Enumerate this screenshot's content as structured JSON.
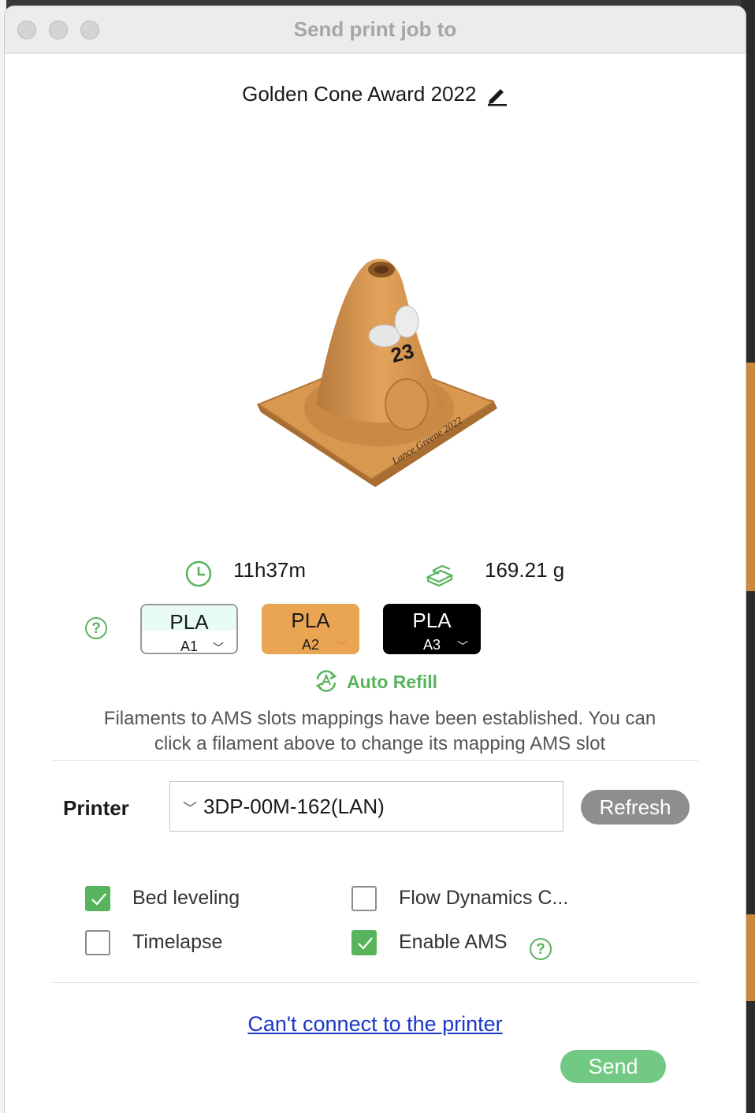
{
  "window": {
    "title": "Send print job to"
  },
  "job": {
    "name": "Golden Cone Award 2022"
  },
  "model_preview": {
    "label_number": "23",
    "engraving": "Lance Greene 2022"
  },
  "stats": {
    "print_time": "11h37m",
    "weight": "169.21 g"
  },
  "filaments": [
    {
      "type": "PLA",
      "slot": "A1",
      "color": "#ffffff"
    },
    {
      "type": "PLA",
      "slot": "A2",
      "color": "#eaa553"
    },
    {
      "type": "PLA",
      "slot": "A3",
      "color": "#000000"
    }
  ],
  "auto_refill": {
    "label": "Auto Refill"
  },
  "mapping_message": {
    "line1": "Filaments to AMS slots mappings have been established. You can",
    "line2": "click a filament above to change its mapping AMS slot"
  },
  "printer": {
    "label": "Printer",
    "selected": "3DP-00M-162(LAN)",
    "refresh_label": "Refresh"
  },
  "options": {
    "bed_leveling": {
      "label": "Bed leveling",
      "checked": true
    },
    "flow_dynamics": {
      "label": "Flow Dynamics C...",
      "checked": false
    },
    "timelapse": {
      "label": "Timelapse",
      "checked": false
    },
    "enable_ams": {
      "label": "Enable AMS",
      "checked": true
    }
  },
  "help_glyph": "?",
  "footer": {
    "cant_connect_link": "Can't connect to the printer",
    "send_label": "Send"
  },
  "colors": {
    "accent_green": "#57b45c",
    "send_green": "#72c983",
    "link_blue": "#1a37c8",
    "refresh_gray": "#8e8e8e"
  }
}
